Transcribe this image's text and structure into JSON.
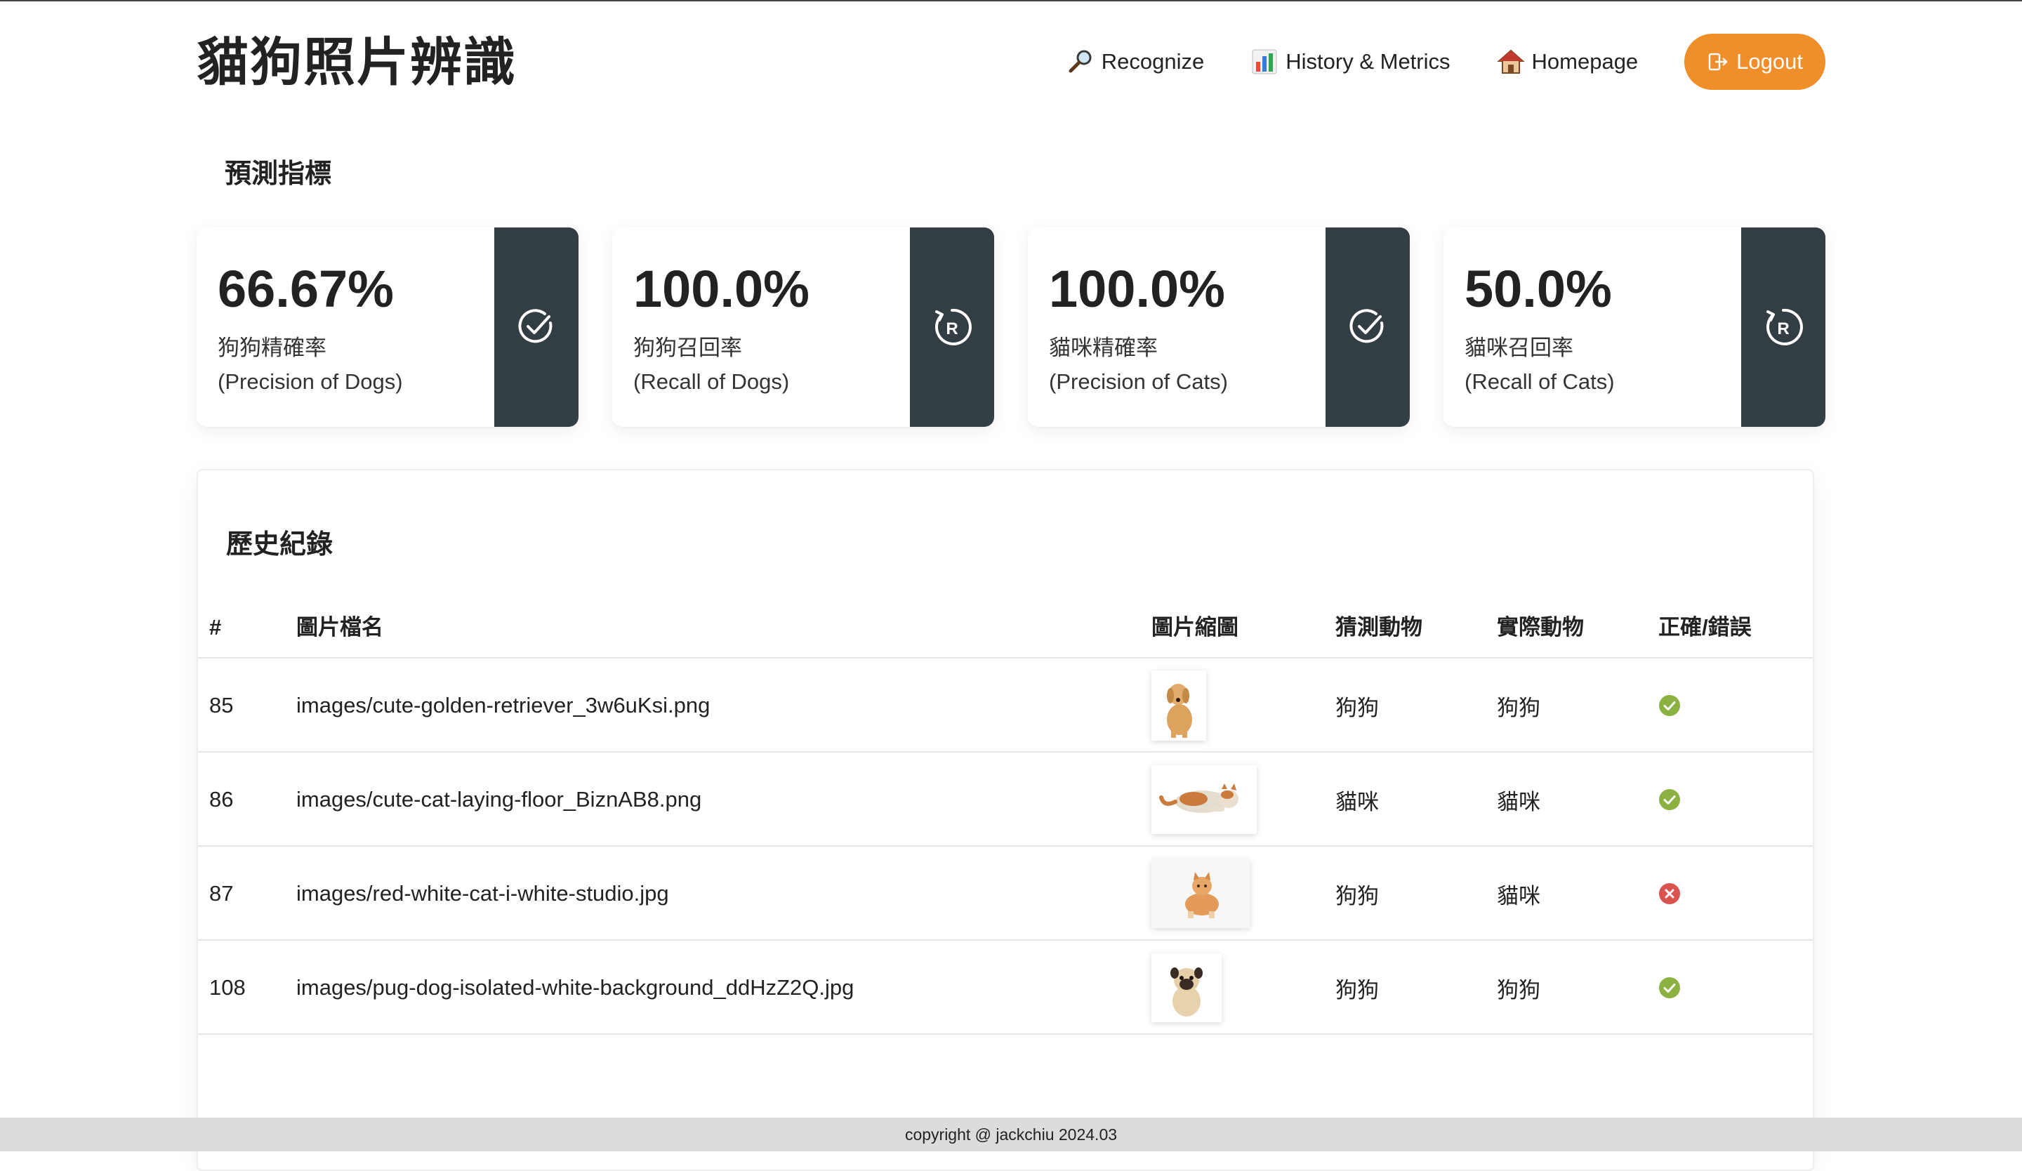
{
  "app": {
    "title": "貓狗照片辨識"
  },
  "nav": {
    "recognize": "Recognize",
    "history": "History & Metrics",
    "homepage": "Homepage",
    "logout": "Logout"
  },
  "metrics": {
    "title": "預測指標",
    "cards": [
      {
        "value": "66.67%",
        "label": "狗狗精確率",
        "sub": "(Precision of Dogs)",
        "icon": "check-circle-icon"
      },
      {
        "value": "100.0%",
        "label": "狗狗召回率",
        "sub": "(Recall of Dogs)",
        "icon": "recall-icon"
      },
      {
        "value": "100.0%",
        "label": "貓咪精確率",
        "sub": "(Precision of Cats)",
        "icon": "check-circle-icon"
      },
      {
        "value": "50.0%",
        "label": "貓咪召回率",
        "sub": "(Recall of Cats)",
        "icon": "recall-icon"
      }
    ]
  },
  "history": {
    "title": "歷史紀錄",
    "headers": {
      "num": "#",
      "file": "圖片檔名",
      "thumb": "圖片縮圖",
      "pred": "猜測動物",
      "actual": "實際動物",
      "correct": "正確/錯誤"
    },
    "rows": [
      {
        "id": "85",
        "file": "images/cute-golden-retriever_3w6uKsi.png",
        "pred": "狗狗",
        "actual": "狗狗",
        "correct": true,
        "thumb": "golden-retriever"
      },
      {
        "id": "86",
        "file": "images/cute-cat-laying-floor_BiznAB8.png",
        "pred": "貓咪",
        "actual": "貓咪",
        "correct": true,
        "thumb": "cat-laying"
      },
      {
        "id": "87",
        "file": "images/red-white-cat-i-white-studio.jpg",
        "pred": "狗狗",
        "actual": "貓咪",
        "correct": false,
        "thumb": "red-white-cat"
      },
      {
        "id": "108",
        "file": "images/pug-dog-isolated-white-background_ddHzZ2Q.jpg",
        "pred": "狗狗",
        "actual": "狗狗",
        "correct": true,
        "thumb": "pug-dog"
      }
    ]
  },
  "colors": {
    "accent": "#f08f2a",
    "card_side": "#333d44",
    "ok": "#8bb241",
    "error": "#d9534f"
  },
  "footer": {
    "text": "copyright @ jackchiu 2024.03"
  }
}
